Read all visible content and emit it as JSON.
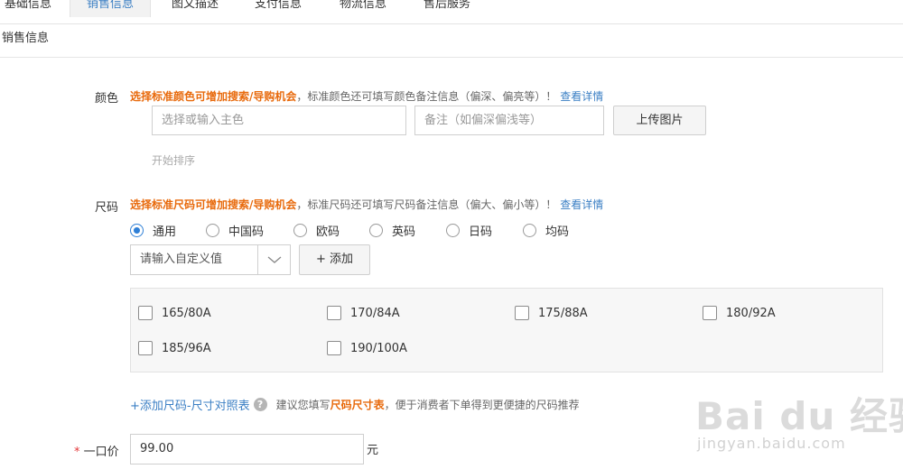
{
  "tabs": [
    {
      "label": "基础信息"
    },
    {
      "label": "销售信息"
    },
    {
      "label": "图文描述"
    },
    {
      "label": "支付信息"
    },
    {
      "label": "物流信息"
    },
    {
      "label": "售后服务"
    }
  ],
  "section_title": "销售信息",
  "color": {
    "label": "颜色",
    "hint_strong": "选择标准颜色可增加搜索/导购机会",
    "hint_normal": "，标准颜色还可填写颜色备注信息（偏深、偏亮等）！",
    "hint_link": "查看详情",
    "main_placeholder": "选择或输入主色",
    "note_placeholder": "备注（如偏深偏浅等）",
    "upload_label": "上传图片",
    "sort_label": "开始排序"
  },
  "size": {
    "label": "尺码",
    "hint_strong": "选择标准尺码可增加搜索/导购机会",
    "hint_normal": "，标准尺码还可填写尺码备注信息（偏大、偏小等）！",
    "hint_link": "查看详情",
    "options": [
      "通用",
      "中国码",
      "欧码",
      "英码",
      "日码",
      "均码"
    ],
    "selected": "通用",
    "custom_placeholder": "请输入自定义值",
    "add_label": "+ 添加",
    "values": [
      "165/80A",
      "170/84A",
      "175/88A",
      "180/92A",
      "185/96A",
      "190/100A"
    ],
    "table_link": "+添加尺码-尺寸对照表",
    "help_icon_text": "?",
    "note_prefix": "建议您填写",
    "note_strong": "尺码尺寸表",
    "note_suffix": "，便于消费者下单得到更便捷的尺码推荐"
  },
  "price": {
    "required_mark": "*",
    "label": "一口价",
    "value": "99.00",
    "unit": "元"
  },
  "watermark": {
    "main": "Bai du 经验",
    "sub": "jingyan.baidu.com"
  }
}
